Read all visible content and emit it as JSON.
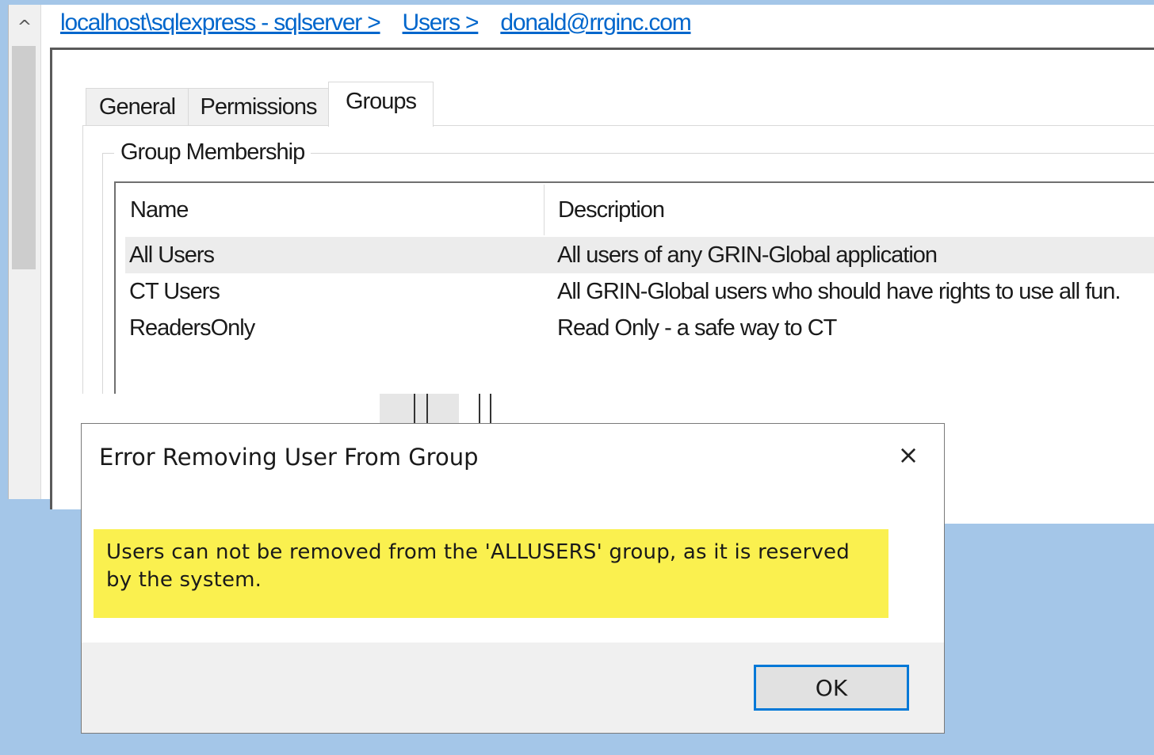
{
  "breadcrumb": {
    "items": [
      "localhost\\sqlexpress - sqlserver >",
      "Users >",
      "donald@rrginc.com"
    ]
  },
  "tabs": {
    "general": "General",
    "permissions": "Permissions",
    "groups": "Groups",
    "active": "Groups"
  },
  "group_membership": {
    "title": "Group Membership",
    "columns": {
      "name": "Name",
      "description": "Description"
    },
    "rows": [
      {
        "name": "All Users",
        "description": "All users of any GRIN-Global application",
        "selected": true
      },
      {
        "name": "CT Users",
        "description": "All GRIN-Global users who should have rights to use all fun.",
        "selected": false
      },
      {
        "name": "ReadersOnly",
        "description": "Read Only - a safe way to CT",
        "selected": false
      }
    ]
  },
  "dialog": {
    "title": "Error Removing User From Group",
    "message": "Users can not be removed from the 'ALLUSERS' group, as it is reserved by the system.",
    "ok_label": "OK",
    "close_icon": "×"
  },
  "icons": {
    "scroll_up": "^"
  },
  "colors": {
    "link": "#0066cc",
    "message_highlight": "#faf04f",
    "ok_button_border": "#0078d7",
    "desktop_background": "#a4c6e8"
  }
}
